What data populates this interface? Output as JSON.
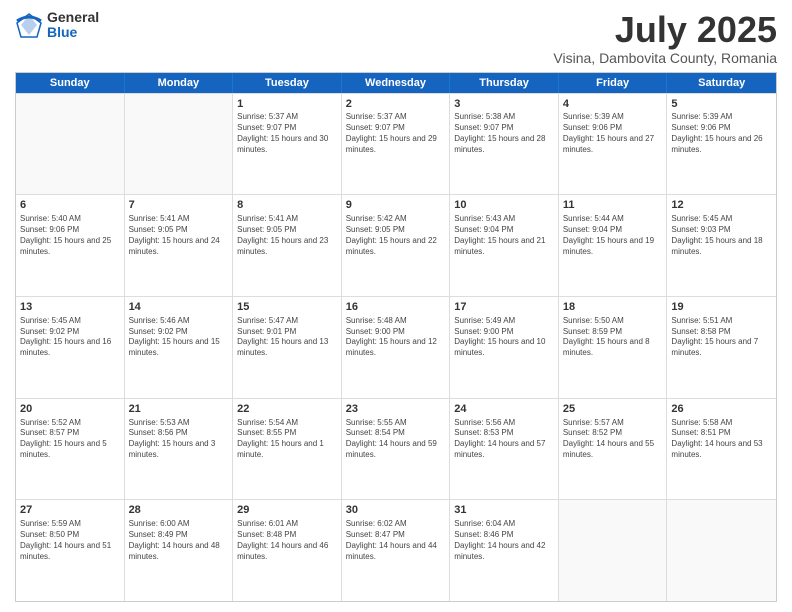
{
  "logo": {
    "general": "General",
    "blue": "Blue"
  },
  "header": {
    "title": "July 2025",
    "subtitle": "Visina, Dambovita County, Romania"
  },
  "weekdays": [
    "Sunday",
    "Monday",
    "Tuesday",
    "Wednesday",
    "Thursday",
    "Friday",
    "Saturday"
  ],
  "rows": [
    [
      {
        "day": "",
        "sunrise": "",
        "sunset": "",
        "daylight": ""
      },
      {
        "day": "",
        "sunrise": "",
        "sunset": "",
        "daylight": ""
      },
      {
        "day": "1",
        "sunrise": "Sunrise: 5:37 AM",
        "sunset": "Sunset: 9:07 PM",
        "daylight": "Daylight: 15 hours and 30 minutes."
      },
      {
        "day": "2",
        "sunrise": "Sunrise: 5:37 AM",
        "sunset": "Sunset: 9:07 PM",
        "daylight": "Daylight: 15 hours and 29 minutes."
      },
      {
        "day": "3",
        "sunrise": "Sunrise: 5:38 AM",
        "sunset": "Sunset: 9:07 PM",
        "daylight": "Daylight: 15 hours and 28 minutes."
      },
      {
        "day": "4",
        "sunrise": "Sunrise: 5:39 AM",
        "sunset": "Sunset: 9:06 PM",
        "daylight": "Daylight: 15 hours and 27 minutes."
      },
      {
        "day": "5",
        "sunrise": "Sunrise: 5:39 AM",
        "sunset": "Sunset: 9:06 PM",
        "daylight": "Daylight: 15 hours and 26 minutes."
      }
    ],
    [
      {
        "day": "6",
        "sunrise": "Sunrise: 5:40 AM",
        "sunset": "Sunset: 9:06 PM",
        "daylight": "Daylight: 15 hours and 25 minutes."
      },
      {
        "day": "7",
        "sunrise": "Sunrise: 5:41 AM",
        "sunset": "Sunset: 9:05 PM",
        "daylight": "Daylight: 15 hours and 24 minutes."
      },
      {
        "day": "8",
        "sunrise": "Sunrise: 5:41 AM",
        "sunset": "Sunset: 9:05 PM",
        "daylight": "Daylight: 15 hours and 23 minutes."
      },
      {
        "day": "9",
        "sunrise": "Sunrise: 5:42 AM",
        "sunset": "Sunset: 9:05 PM",
        "daylight": "Daylight: 15 hours and 22 minutes."
      },
      {
        "day": "10",
        "sunrise": "Sunrise: 5:43 AM",
        "sunset": "Sunset: 9:04 PM",
        "daylight": "Daylight: 15 hours and 21 minutes."
      },
      {
        "day": "11",
        "sunrise": "Sunrise: 5:44 AM",
        "sunset": "Sunset: 9:04 PM",
        "daylight": "Daylight: 15 hours and 19 minutes."
      },
      {
        "day": "12",
        "sunrise": "Sunrise: 5:45 AM",
        "sunset": "Sunset: 9:03 PM",
        "daylight": "Daylight: 15 hours and 18 minutes."
      }
    ],
    [
      {
        "day": "13",
        "sunrise": "Sunrise: 5:45 AM",
        "sunset": "Sunset: 9:02 PM",
        "daylight": "Daylight: 15 hours and 16 minutes."
      },
      {
        "day": "14",
        "sunrise": "Sunrise: 5:46 AM",
        "sunset": "Sunset: 9:02 PM",
        "daylight": "Daylight: 15 hours and 15 minutes."
      },
      {
        "day": "15",
        "sunrise": "Sunrise: 5:47 AM",
        "sunset": "Sunset: 9:01 PM",
        "daylight": "Daylight: 15 hours and 13 minutes."
      },
      {
        "day": "16",
        "sunrise": "Sunrise: 5:48 AM",
        "sunset": "Sunset: 9:00 PM",
        "daylight": "Daylight: 15 hours and 12 minutes."
      },
      {
        "day": "17",
        "sunrise": "Sunrise: 5:49 AM",
        "sunset": "Sunset: 9:00 PM",
        "daylight": "Daylight: 15 hours and 10 minutes."
      },
      {
        "day": "18",
        "sunrise": "Sunrise: 5:50 AM",
        "sunset": "Sunset: 8:59 PM",
        "daylight": "Daylight: 15 hours and 8 minutes."
      },
      {
        "day": "19",
        "sunrise": "Sunrise: 5:51 AM",
        "sunset": "Sunset: 8:58 PM",
        "daylight": "Daylight: 15 hours and 7 minutes."
      }
    ],
    [
      {
        "day": "20",
        "sunrise": "Sunrise: 5:52 AM",
        "sunset": "Sunset: 8:57 PM",
        "daylight": "Daylight: 15 hours and 5 minutes."
      },
      {
        "day": "21",
        "sunrise": "Sunrise: 5:53 AM",
        "sunset": "Sunset: 8:56 PM",
        "daylight": "Daylight: 15 hours and 3 minutes."
      },
      {
        "day": "22",
        "sunrise": "Sunrise: 5:54 AM",
        "sunset": "Sunset: 8:55 PM",
        "daylight": "Daylight: 15 hours and 1 minute."
      },
      {
        "day": "23",
        "sunrise": "Sunrise: 5:55 AM",
        "sunset": "Sunset: 8:54 PM",
        "daylight": "Daylight: 14 hours and 59 minutes."
      },
      {
        "day": "24",
        "sunrise": "Sunrise: 5:56 AM",
        "sunset": "Sunset: 8:53 PM",
        "daylight": "Daylight: 14 hours and 57 minutes."
      },
      {
        "day": "25",
        "sunrise": "Sunrise: 5:57 AM",
        "sunset": "Sunset: 8:52 PM",
        "daylight": "Daylight: 14 hours and 55 minutes."
      },
      {
        "day": "26",
        "sunrise": "Sunrise: 5:58 AM",
        "sunset": "Sunset: 8:51 PM",
        "daylight": "Daylight: 14 hours and 53 minutes."
      }
    ],
    [
      {
        "day": "27",
        "sunrise": "Sunrise: 5:59 AM",
        "sunset": "Sunset: 8:50 PM",
        "daylight": "Daylight: 14 hours and 51 minutes."
      },
      {
        "day": "28",
        "sunrise": "Sunrise: 6:00 AM",
        "sunset": "Sunset: 8:49 PM",
        "daylight": "Daylight: 14 hours and 48 minutes."
      },
      {
        "day": "29",
        "sunrise": "Sunrise: 6:01 AM",
        "sunset": "Sunset: 8:48 PM",
        "daylight": "Daylight: 14 hours and 46 minutes."
      },
      {
        "day": "30",
        "sunrise": "Sunrise: 6:02 AM",
        "sunset": "Sunset: 8:47 PM",
        "daylight": "Daylight: 14 hours and 44 minutes."
      },
      {
        "day": "31",
        "sunrise": "Sunrise: 6:04 AM",
        "sunset": "Sunset: 8:46 PM",
        "daylight": "Daylight: 14 hours and 42 minutes."
      },
      {
        "day": "",
        "sunrise": "",
        "sunset": "",
        "daylight": ""
      },
      {
        "day": "",
        "sunrise": "",
        "sunset": "",
        "daylight": ""
      }
    ]
  ]
}
